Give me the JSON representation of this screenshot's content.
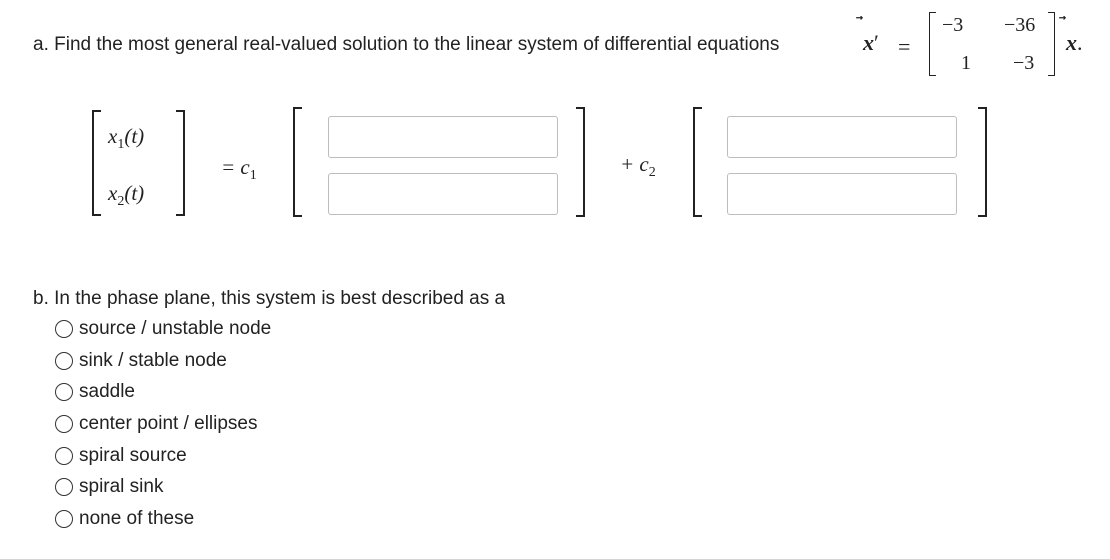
{
  "part_a": {
    "prefix": "a. Find the most general real-valued solution to the linear system of differential equations",
    "vector_symbol": "x",
    "arrow": "⃗",
    "prime": "′",
    "equals": "=",
    "period": ".",
    "matrix": {
      "r1c1": "−3",
      "r1c2": "−36",
      "r2c1": "1",
      "r2c2": "−3"
    }
  },
  "solution": {
    "x1": "x",
    "x1_sub": "1",
    "x2": "x",
    "x2_sub": "2",
    "t_arg": "(t)",
    "equals_c1": "= c",
    "c1_sub": "1",
    "plus_c2": "+ c",
    "c2_sub": "2",
    "inputs": {
      "v1_top": "",
      "v1_bottom": "",
      "v2_top": "",
      "v2_bottom": ""
    }
  },
  "part_b": {
    "question": "b. In the phase plane, this system is best described as a",
    "options": [
      "source / unstable node",
      "sink / stable node",
      "saddle",
      "center point / ellipses",
      "spiral source",
      "spiral sink",
      "none of these"
    ]
  }
}
